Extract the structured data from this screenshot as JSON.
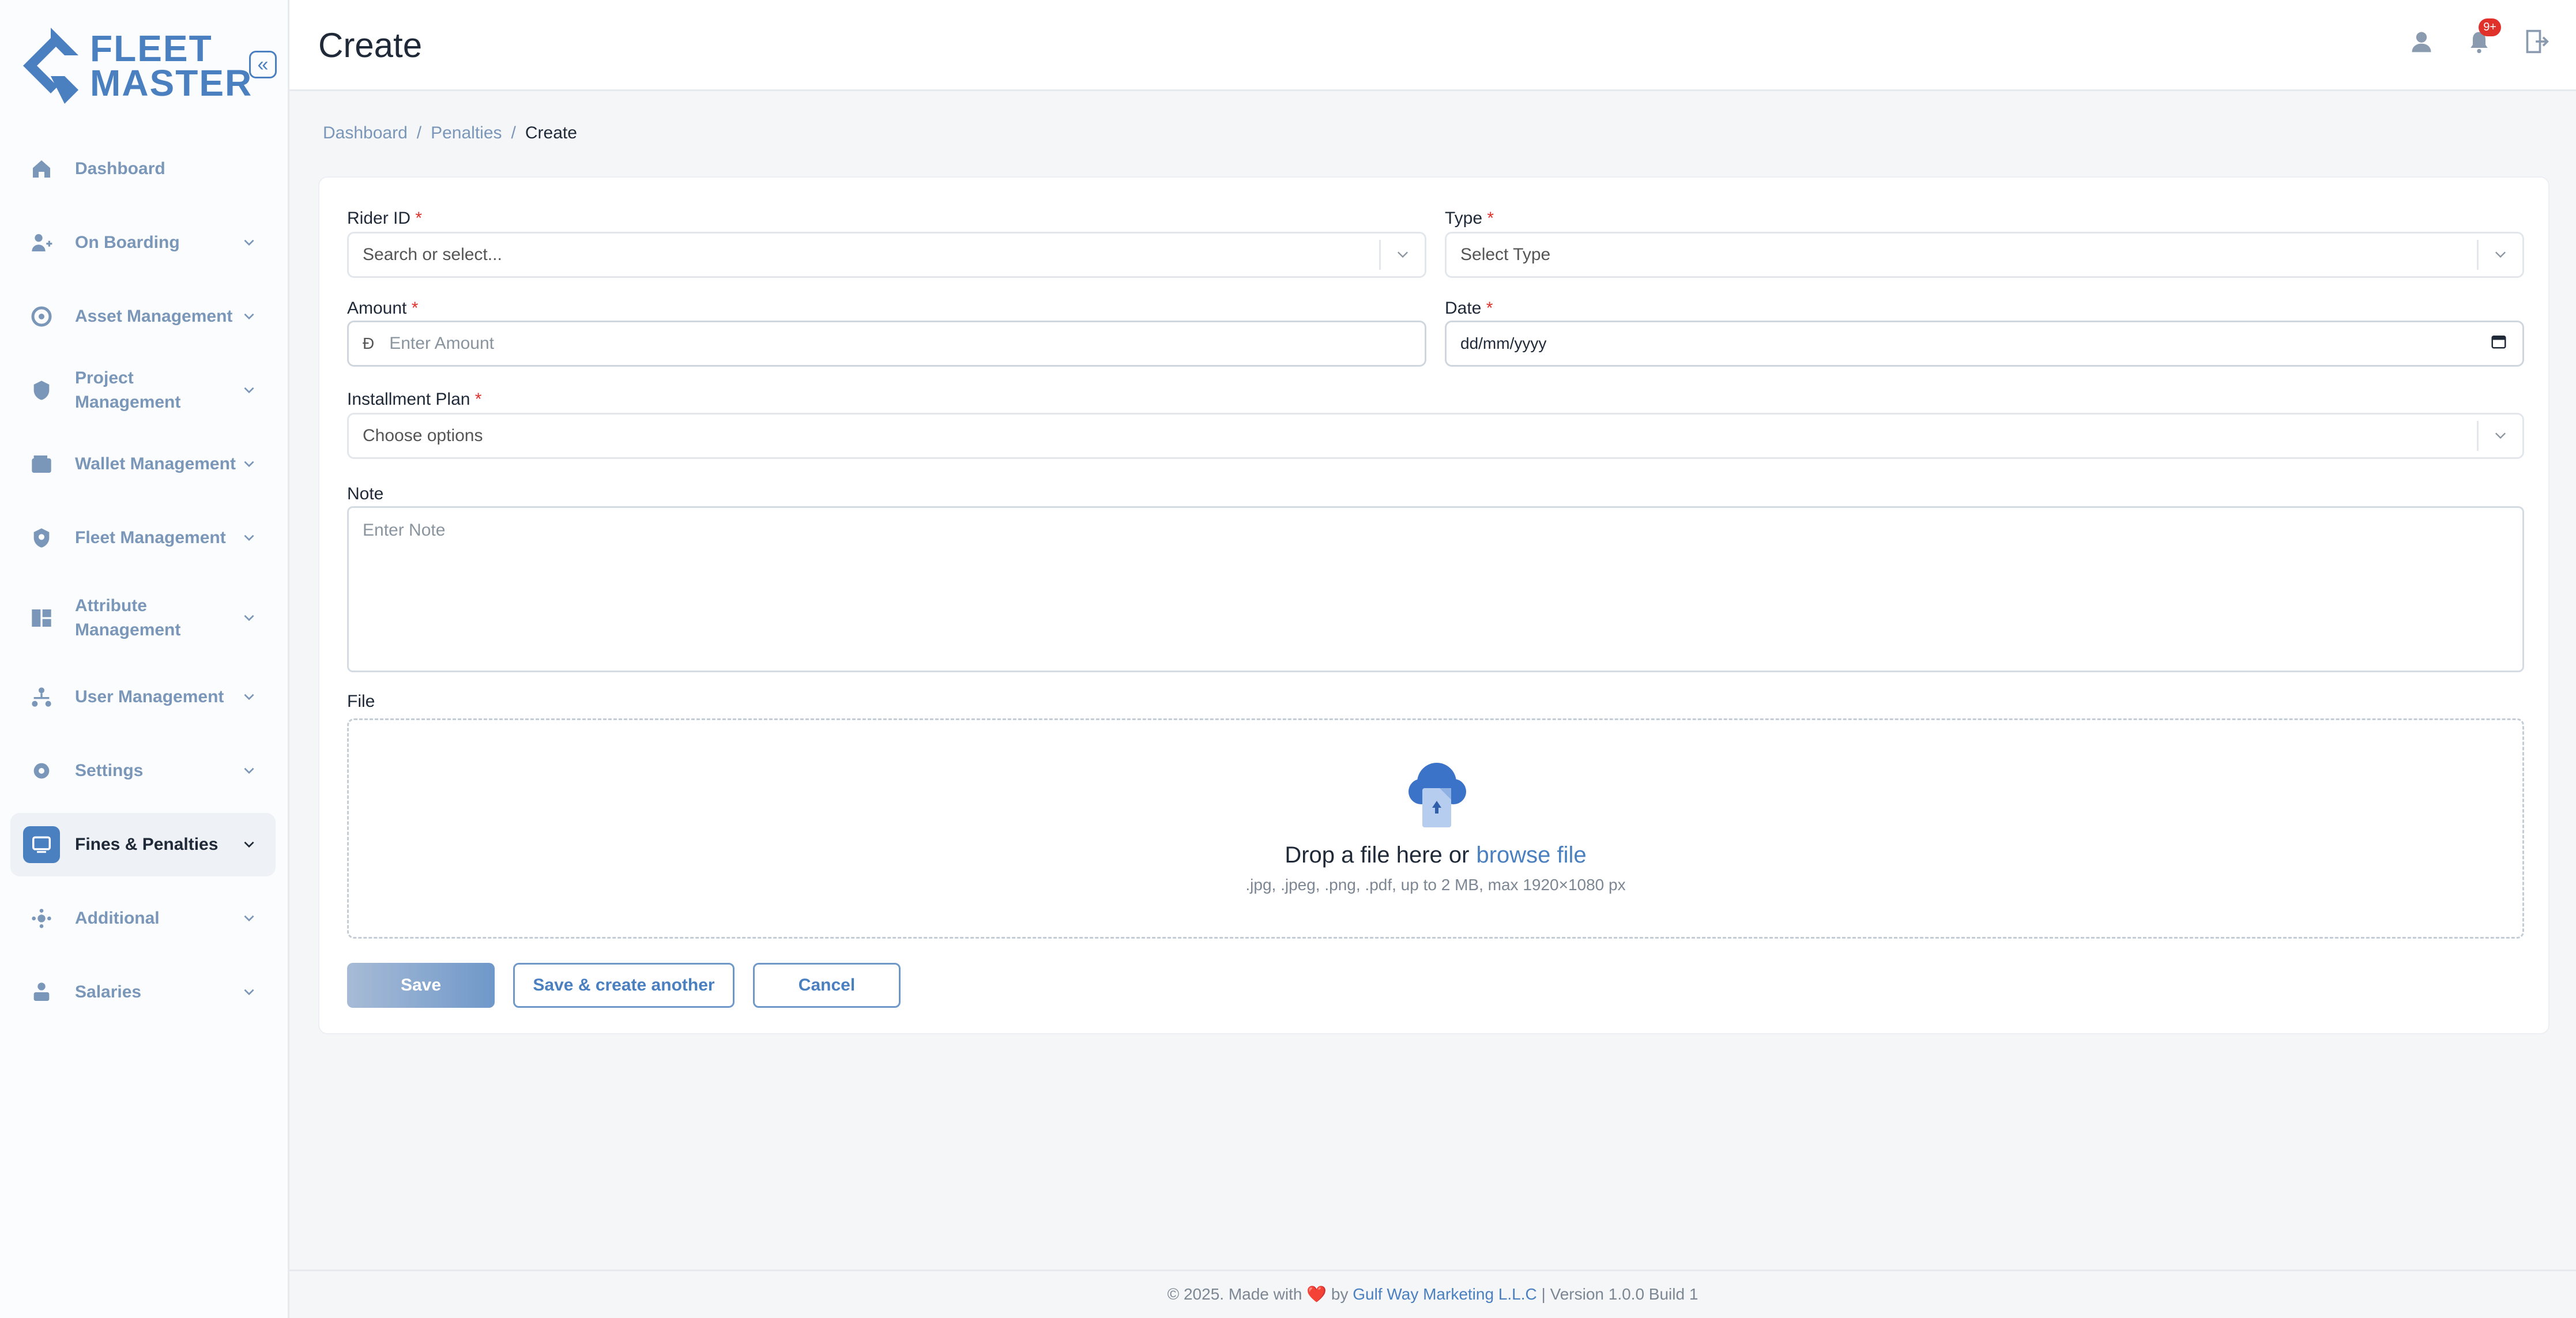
{
  "app": {
    "logo_line1": "FLEET",
    "logo_line2": "MASTER",
    "accent": "#4a7fc0",
    "collapse_icon": "double-chevron-left-icon"
  },
  "sidebar": {
    "items": [
      {
        "label": "Dashboard",
        "icon": "home-icon",
        "has_chevron": false
      },
      {
        "label": "On Boarding",
        "icon": "user-plus-icon",
        "has_chevron": true
      },
      {
        "label": "Asset Management",
        "icon": "asset-icon",
        "has_chevron": true
      },
      {
        "label": "Project Management",
        "icon": "project-icon",
        "has_chevron": true
      },
      {
        "label": "Wallet Management",
        "icon": "wallet-icon",
        "has_chevron": true
      },
      {
        "label": "Fleet Management",
        "icon": "fleet-icon",
        "has_chevron": true
      },
      {
        "label": "Attribute Management",
        "icon": "attribute-icon",
        "has_chevron": true
      },
      {
        "label": "User Management",
        "icon": "user-tree-icon",
        "has_chevron": true
      },
      {
        "label": "Settings",
        "icon": "gear-icon",
        "has_chevron": true
      },
      {
        "label": "Fines & Penalties",
        "icon": "fines-icon",
        "has_chevron": true,
        "active": true
      },
      {
        "label": "Additional",
        "icon": "additional-icon",
        "has_chevron": true
      },
      {
        "label": "Salaries",
        "icon": "salary-icon",
        "has_chevron": true
      }
    ]
  },
  "header": {
    "title": "Create",
    "notification_badge": "9+"
  },
  "breadcrumb": {
    "items": [
      "Dashboard",
      "Penalties",
      "Create"
    ],
    "separator": "/"
  },
  "form": {
    "rider_id": {
      "label": "Rider ID",
      "required": "*",
      "placeholder": "Search or select..."
    },
    "type": {
      "label": "Type",
      "required": "*",
      "placeholder": "Select Type"
    },
    "amount": {
      "label": "Amount",
      "required": "*",
      "currency_symbol": "Đ",
      "placeholder": "Enter Amount"
    },
    "date": {
      "label": "Date",
      "required": "*",
      "placeholder": "dd/mm/yyyy"
    },
    "installment_plan": {
      "label": "Installment Plan",
      "required": "*",
      "placeholder": "Choose options"
    },
    "note": {
      "label": "Note",
      "placeholder": "Enter Note"
    },
    "file": {
      "label": "File",
      "drop_text": "Drop a file here or",
      "browse_link": "browse file",
      "hint": ".jpg, .jpeg, .png, .pdf, up to 2 MB, max 1920×1080 px"
    },
    "buttons": {
      "save": "Save",
      "save_create_another": "Save & create another",
      "cancel": "Cancel"
    }
  },
  "footer": {
    "prefix": "© 2025. Made with",
    "heart": "❤️",
    "by": "by",
    "company": "Gulf Way Marketing L.L.C",
    "version": "| Version 1.0.0 Build 1"
  }
}
